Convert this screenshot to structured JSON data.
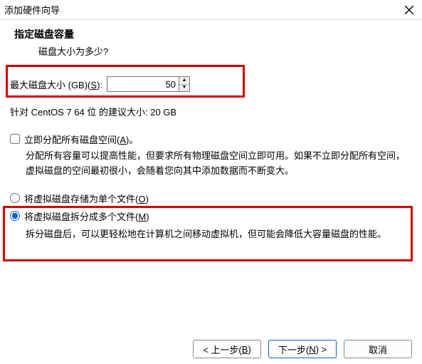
{
  "titlebar": {
    "title": "添加硬件向导"
  },
  "header": {
    "title": "指定磁盘容量",
    "subtitle": "磁盘大小为多少?"
  },
  "size": {
    "label_pre": "最大磁盘大小 (GB)(",
    "label_u": "S",
    "label_post": "):",
    "value": "50"
  },
  "recommend": {
    "text": "针对 CentOS 7 64 位 的建议大小: 20 GB"
  },
  "allocateNow": {
    "label_pre": "立即分配所有磁盘空间(",
    "label_u": "A",
    "label_post": ")。",
    "desc": "分配所有容量可以提高性能，但要求所有物理磁盘空间立即可用。如果不立即分配所有空间，虚拟磁盘的空间最初很小，会随着您向其中添加数据而不断变大。"
  },
  "radio_single": {
    "label_pre": "将虚拟磁盘存储为单个文件(",
    "label_u": "O",
    "label_post": ")"
  },
  "radio_multi": {
    "label_pre": "将虚拟磁盘拆分成多个文件(",
    "label_u": "M",
    "label_post": ")",
    "desc": "拆分磁盘后，可以更轻松地在计算机之间移动虚拟机，但可能会降低大容量磁盘的性能。"
  },
  "footer": {
    "back_pre": "< 上一步(",
    "back_u": "B",
    "back_post": ")",
    "next_pre": "下一步(",
    "next_u": "N",
    "next_post": ") >",
    "cancel": "取消"
  }
}
